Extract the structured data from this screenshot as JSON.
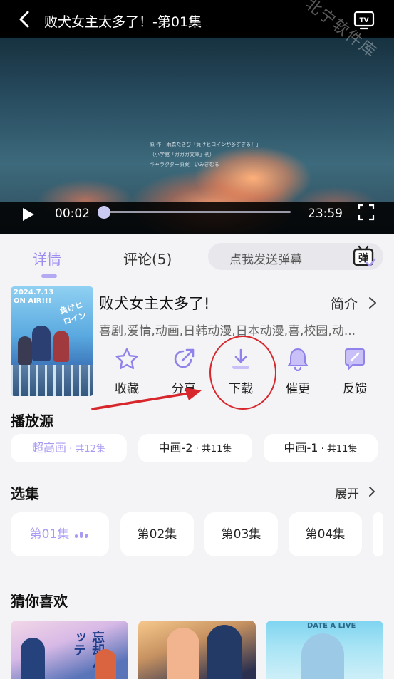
{
  "player": {
    "title": "败犬女主太多了！-第01集",
    "watermark": "北宁软件库",
    "credits": [
      "原 作　雨森たきび「負けヒロインが多すぎる！」",
      "（小学館「ガガガ文庫」刊）",
      "",
      "キャラクター原案　いみぎむる"
    ],
    "current_time": "00:02",
    "total_time": "23:59",
    "progress": 0.005
  },
  "tabs": {
    "details": "详情",
    "comments": "评论(5)"
  },
  "danmaku": {
    "placeholder": "点我发送弹幕",
    "icon_label": "弹"
  },
  "show": {
    "title": "败犬女主太多了!",
    "intro_label": "简介",
    "tags": "喜剧,爱情,动画,日韩动漫,日本动漫,喜,校园,动...",
    "poster_date": "2024.7.13",
    "poster_sub": "ON AIR!!!",
    "poster_logo": "負けヒロイン"
  },
  "actions": [
    {
      "label": "收藏",
      "icon": "star-icon"
    },
    {
      "label": "分享",
      "icon": "share-icon"
    },
    {
      "label": "下载",
      "icon": "download-icon"
    },
    {
      "label": "催更",
      "icon": "bell-icon"
    },
    {
      "label": "反馈",
      "icon": "feedback-icon"
    }
  ],
  "sources": {
    "heading": "播放源",
    "items": [
      {
        "name": "超高画",
        "count": " · 共12集",
        "active": true
      },
      {
        "name": "中画-2",
        "count": " · 共11集",
        "active": false
      },
      {
        "name": "中画-1",
        "count": " · 共11集",
        "active": false
      }
    ]
  },
  "episodes": {
    "heading": "选集",
    "expand": "展开",
    "items": [
      "第01集",
      "第02集",
      "第03集",
      "第04集"
    ]
  },
  "recommend": {
    "heading": "猜你喜欢",
    "items": [
      {
        "overlay": "忘却バッテ"
      },
      {
        "overlay": ""
      },
      {
        "overlay": "DATE A LIVE"
      }
    ]
  },
  "colors": {
    "accent": "#a89cf2",
    "annotation": "#d8262d",
    "background": "#f4f4f6"
  }
}
